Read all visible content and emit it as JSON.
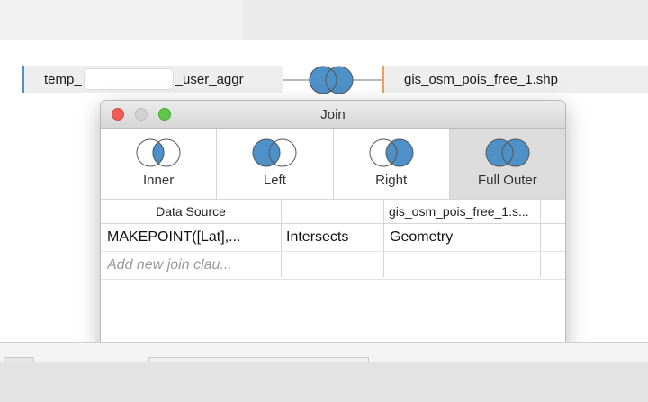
{
  "canvas": {
    "left_table_prefix": "temp_",
    "left_table_suffix": "_user_aggr",
    "right_table": "gis_osm_pois_free_1.shp",
    "connector_icon": "full-outer-join-icon"
  },
  "dialog": {
    "title": "Join",
    "join_types": [
      {
        "label": "Inner",
        "icon": "inner-join-icon"
      },
      {
        "label": "Left",
        "icon": "left-join-icon"
      },
      {
        "label": "Right",
        "icon": "right-join-icon"
      },
      {
        "label": "Full Outer",
        "icon": "full-outer-join-icon"
      }
    ],
    "selected_join": "Full Outer",
    "grid": {
      "headers": [
        "Data Source",
        "",
        "gis_osm_pois_free_1.s..."
      ],
      "rows": [
        {
          "left": "MAKEPOINT([Lat],...",
          "operator": "Intersects",
          "right": "Geometry"
        }
      ],
      "add_placeholder": "Add new join clau..."
    }
  },
  "colors": {
    "accent_blue": "#4e90c8",
    "accent_orange": "#e6a060",
    "selected_bg": "#dcdcdc"
  }
}
